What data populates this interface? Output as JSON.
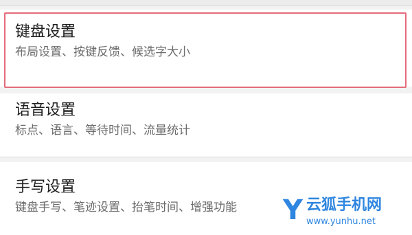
{
  "settings": {
    "items": [
      {
        "title": "键盘设置",
        "subtitle": "布局设置、按键反馈、候选字大小"
      },
      {
        "title": "语音设置",
        "subtitle": "标点、语言、等待时间、流量统计"
      },
      {
        "title": "手写设置",
        "subtitle": "键盘手写、笔迹设置、抬笔时间、增强功能"
      }
    ]
  },
  "highlight": {
    "color": "#e46b7a"
  },
  "watermark": {
    "logo_letter": "Y",
    "site_name": "云狐手机网",
    "url": "www.yunhu.net"
  }
}
